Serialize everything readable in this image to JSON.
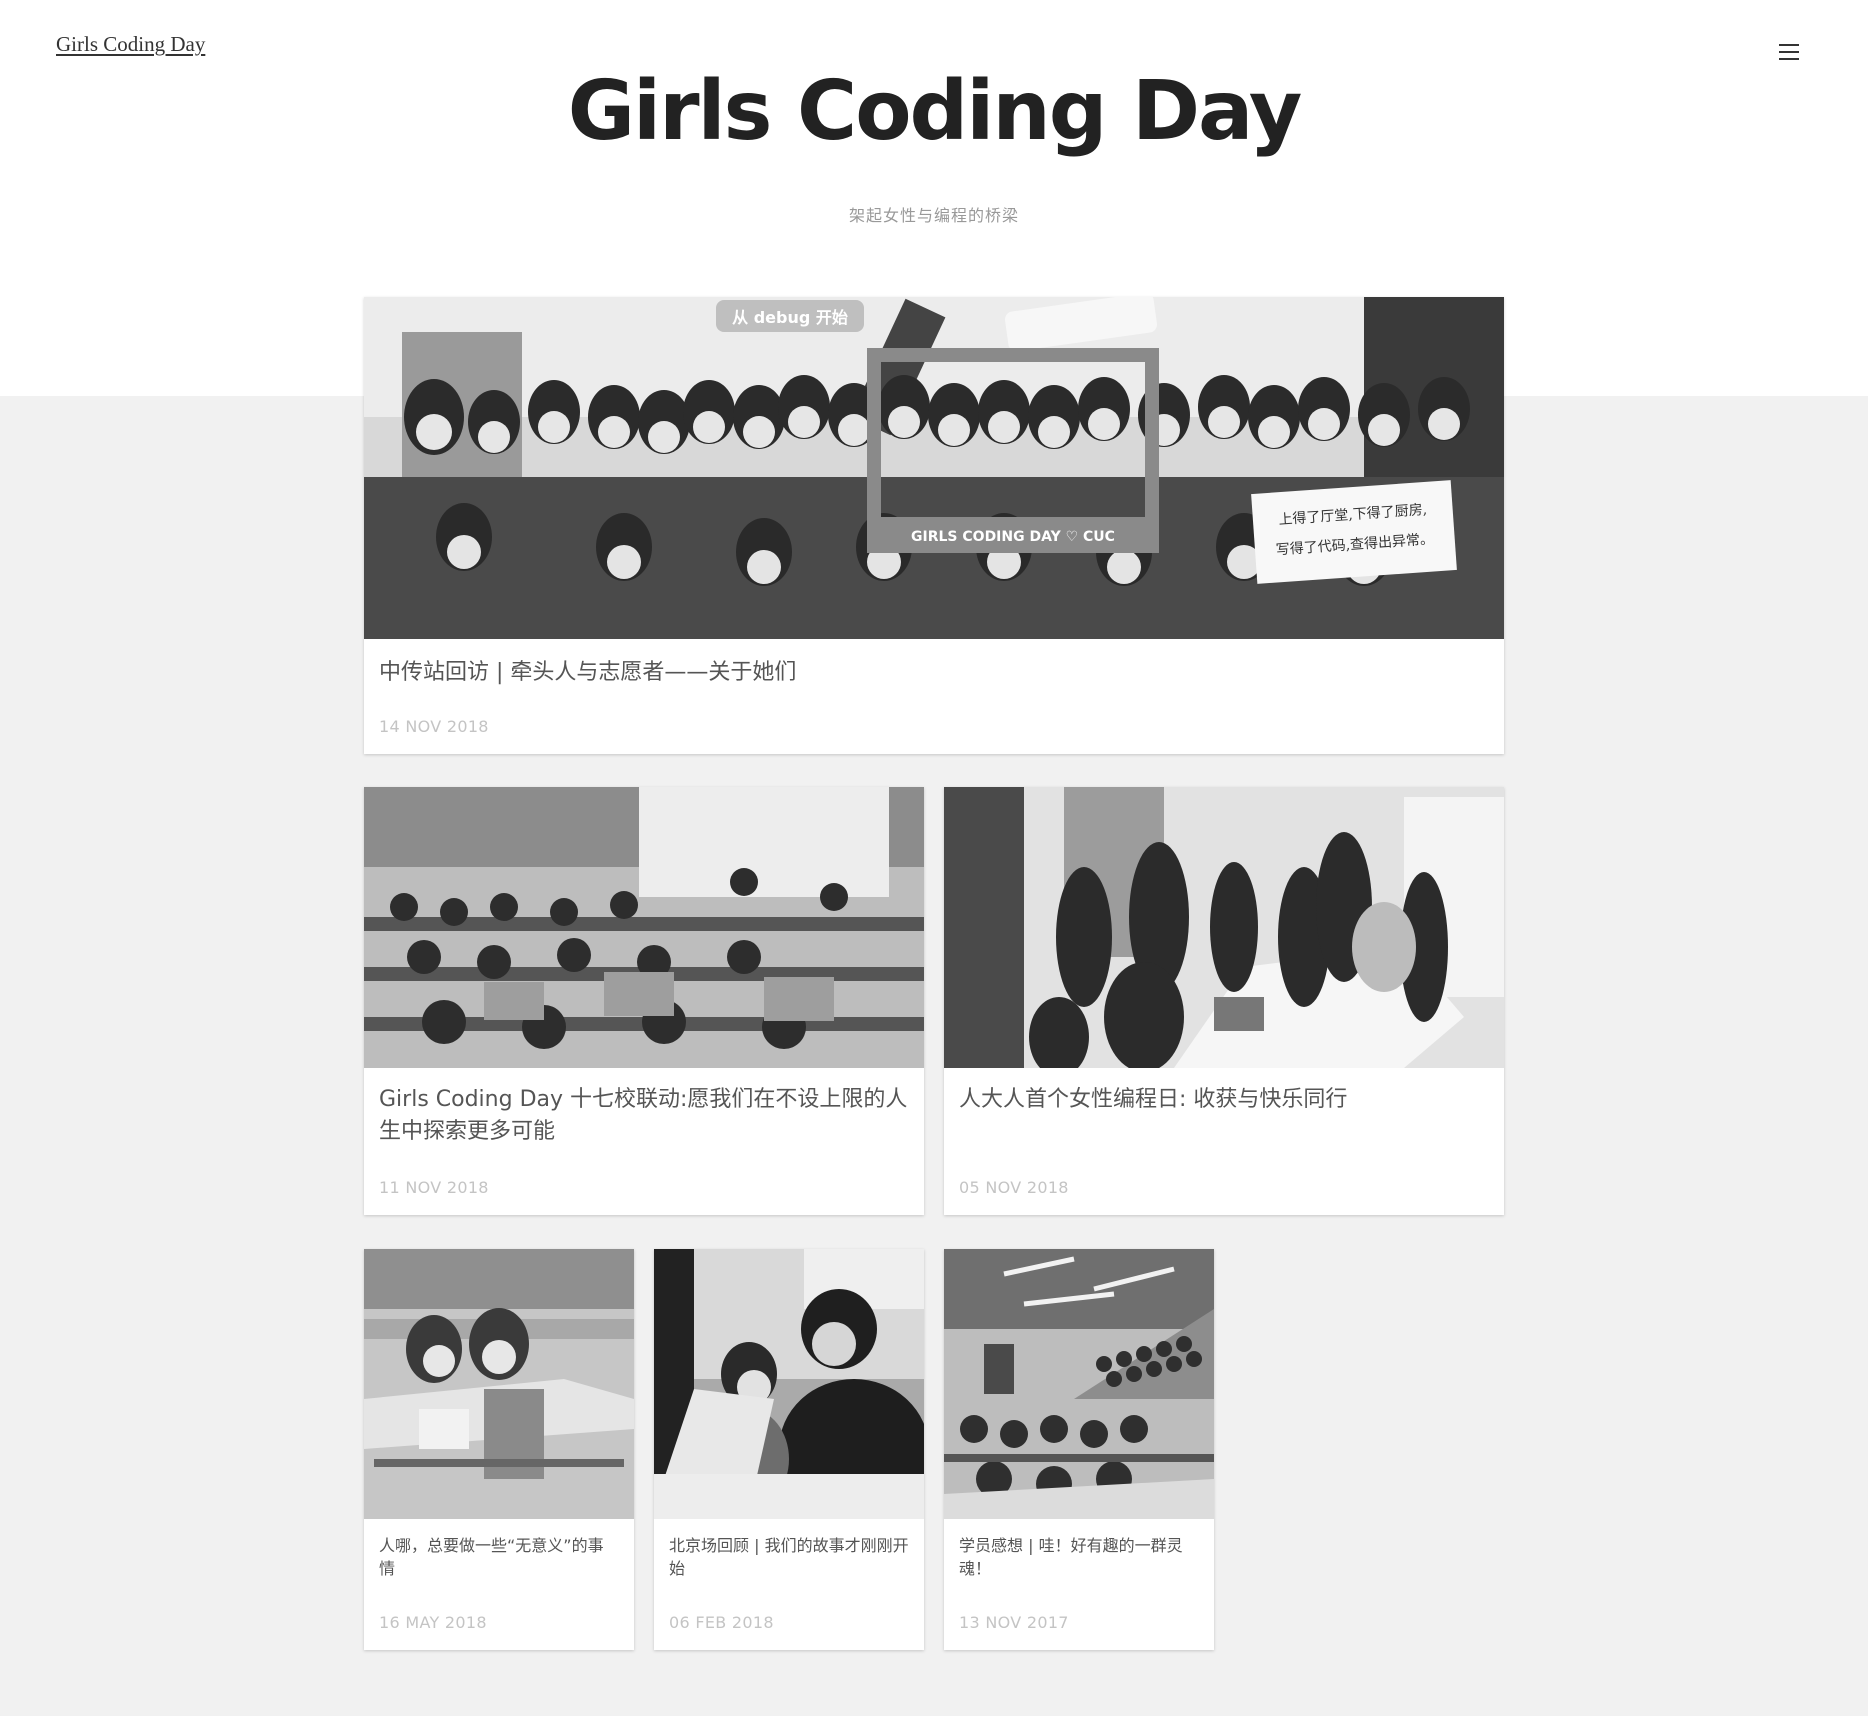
{
  "header": {
    "site_link": "Girls Coding Day",
    "menu_icon": "hamburger-menu-icon"
  },
  "hero": {
    "title": "Girls Coding Day",
    "subtitle": "架起女性与编程的桥梁"
  },
  "posts": [
    {
      "title": "中传站回访 | 牵头人与志愿者——关于她们",
      "date": "14 NOV 2018",
      "image": "group-photo"
    },
    {
      "title": "Girls Coding Day 十七校联动:愿我们在不设上限的人生中探索更多可能",
      "date": "11 NOV 2018",
      "image": "classroom-photo"
    },
    {
      "title": "人大人首个女性编程日:  收获与快乐同行",
      "date": "05 NOV 2018",
      "image": "registration-photo"
    },
    {
      "title": "人哪，总要做一些“无意义”的事情",
      "date": "16 MAY 2018",
      "image": "pair-coding-photo"
    },
    {
      "title": "北京场回顾 | 我们的故事才刚刚开始",
      "date": "06 FEB 2018",
      "image": "mentor-photo"
    },
    {
      "title": "学员感想 | 哇！好有趣的一群灵魂！",
      "date": "13 NOV 2017",
      "image": "auditorium-photo"
    }
  ],
  "photo_texts": {
    "banner": "从 debug 开始",
    "frame": "GIRLS CODING DAY ♡ CUC",
    "sign_line1": "上得了厅堂,下得了厨房,",
    "sign_line2": "写得了代码,查得出异常。"
  }
}
